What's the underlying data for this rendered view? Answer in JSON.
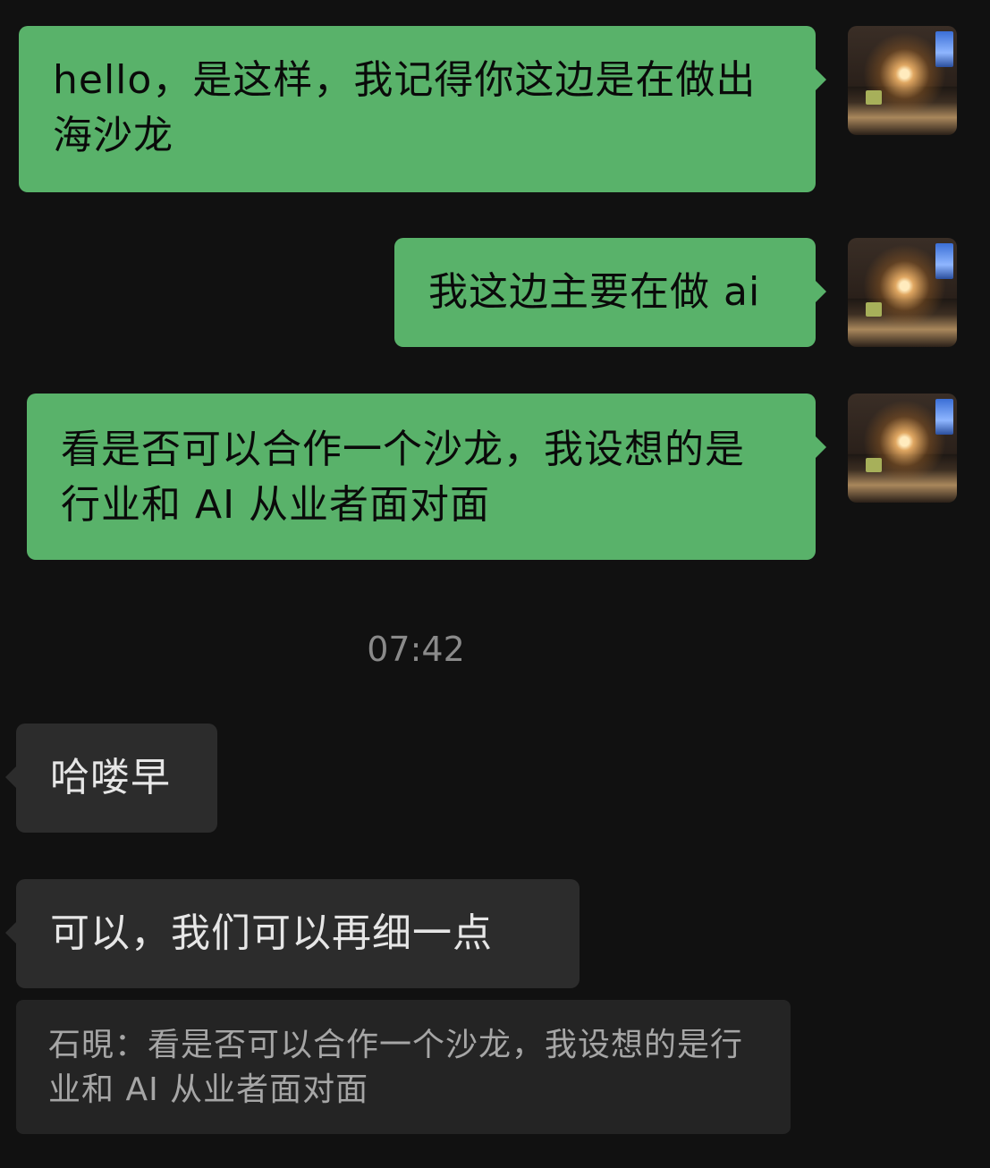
{
  "messages": [
    {
      "direction": "out",
      "text": "hello，是这样，我记得你这边是在做出海沙龙"
    },
    {
      "direction": "out",
      "text": "我这边主要在做 ai"
    },
    {
      "direction": "out",
      "text": "看是否可以合作一个沙龙，我设想的是行业和 AI 从业者面对面"
    },
    {
      "direction": "in",
      "text": "哈喽早"
    },
    {
      "direction": "in",
      "text": "可以，我们可以再细一点"
    }
  ],
  "timestamp": "07:42",
  "quote": {
    "text": "石晛：看是否可以合作一个沙龙，我设想的是行业和 AI 从业者面对面"
  },
  "colors": {
    "background": "#111111",
    "outgoing_bubble": "#59b26a",
    "incoming_bubble": "#2c2c2c",
    "quote_bg": "#242424",
    "timestamp": "#8a8a8a"
  }
}
